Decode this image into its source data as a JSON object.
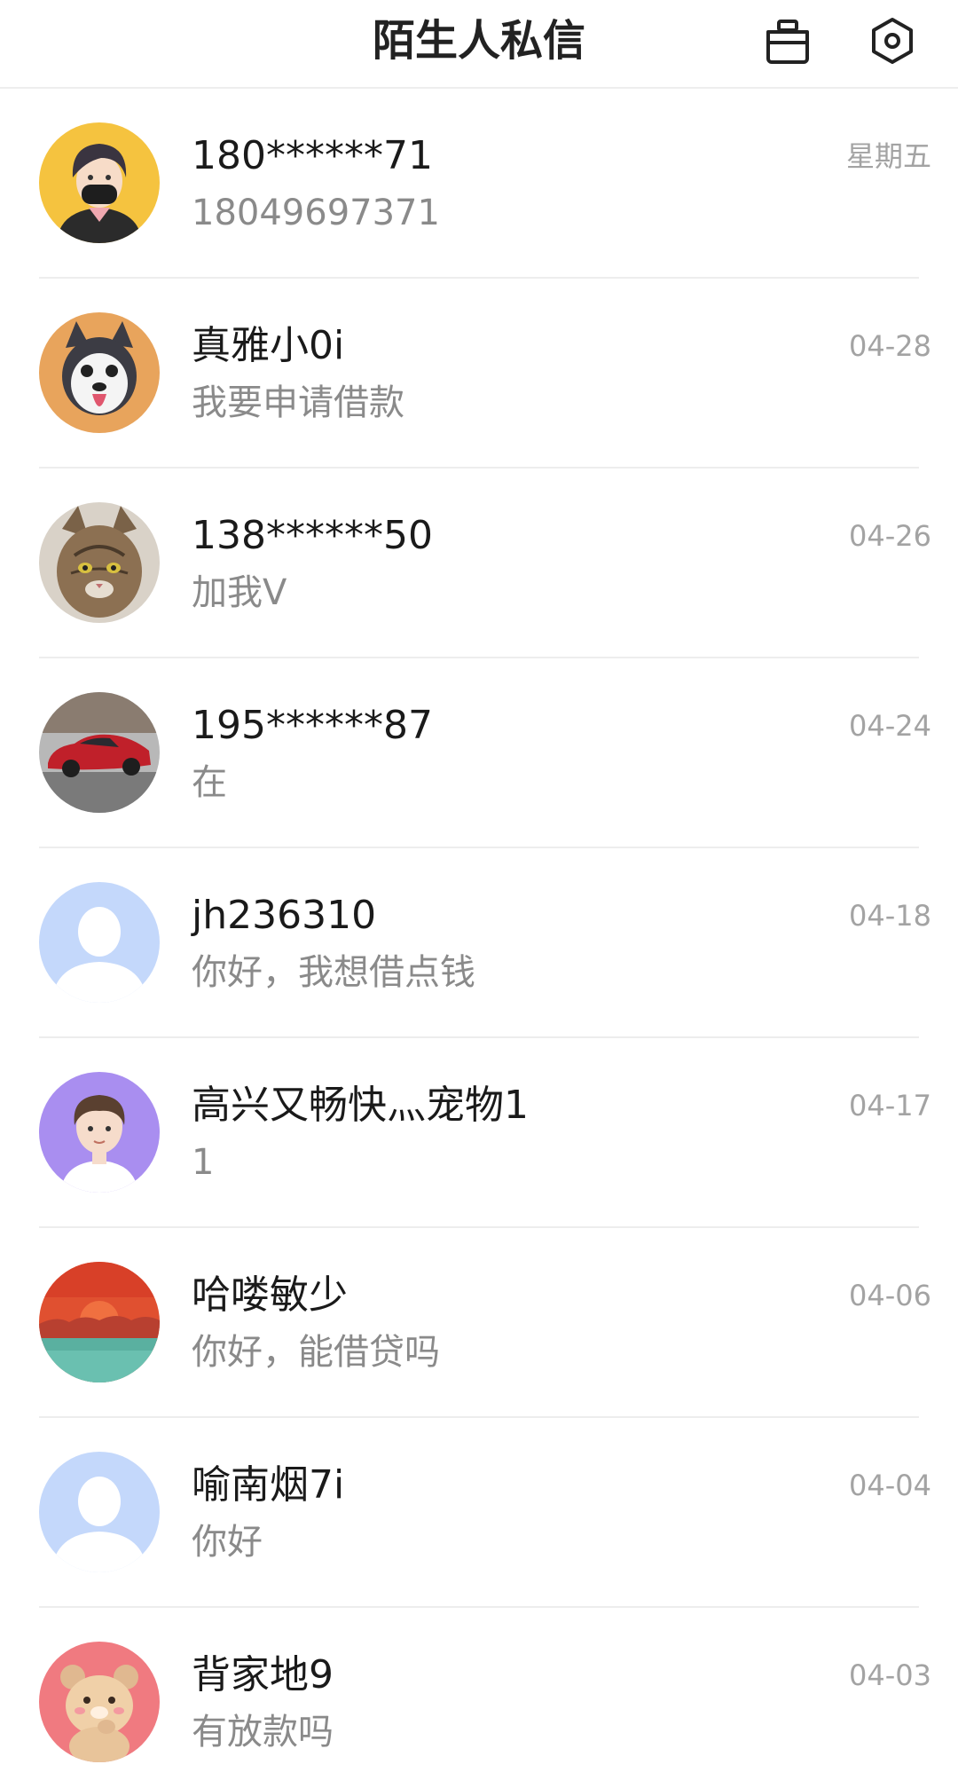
{
  "header": {
    "title": "陌生人私信",
    "clean_icon": "clean-bucket-icon",
    "settings_icon": "settings-hex-icon"
  },
  "conversations": [
    {
      "name": "180******71",
      "message": "18049697371",
      "time": "星期五",
      "avatar": "anime-boy-mask-avatar"
    },
    {
      "name": "真雅小0i",
      "message": "我要申请借款",
      "time": "04-28",
      "avatar": "husky-dog-avatar"
    },
    {
      "name": "138******50",
      "message": "加我V",
      "time": "04-26",
      "avatar": "cat-photo-avatar"
    },
    {
      "name": "195******87",
      "message": "在",
      "time": "04-24",
      "avatar": "red-sports-car-avatar"
    },
    {
      "name": "jh236310",
      "message": "你好，我想借点钱",
      "time": "04-18",
      "avatar": "default-user-avatar"
    },
    {
      "name": "高兴又畅快灬宠物1",
      "message": "1",
      "time": "04-17",
      "avatar": "cartoon-boy-avatar"
    },
    {
      "name": "哈喽敏少",
      "message": "你好，能借贷吗",
      "time": "04-06",
      "avatar": "sunset-landscape-avatar"
    },
    {
      "name": "喻南烟7i",
      "message": "你好",
      "time": "04-04",
      "avatar": "default-user-avatar"
    },
    {
      "name": "背家地9",
      "message": "有放款吗",
      "time": "04-03",
      "avatar": "cartoon-bear-avatar"
    }
  ],
  "colors": {
    "text_primary": "#1a1a1a",
    "text_secondary": "#8a8a8a",
    "time": "#a3a3a3",
    "divider": "#ededed"
  }
}
